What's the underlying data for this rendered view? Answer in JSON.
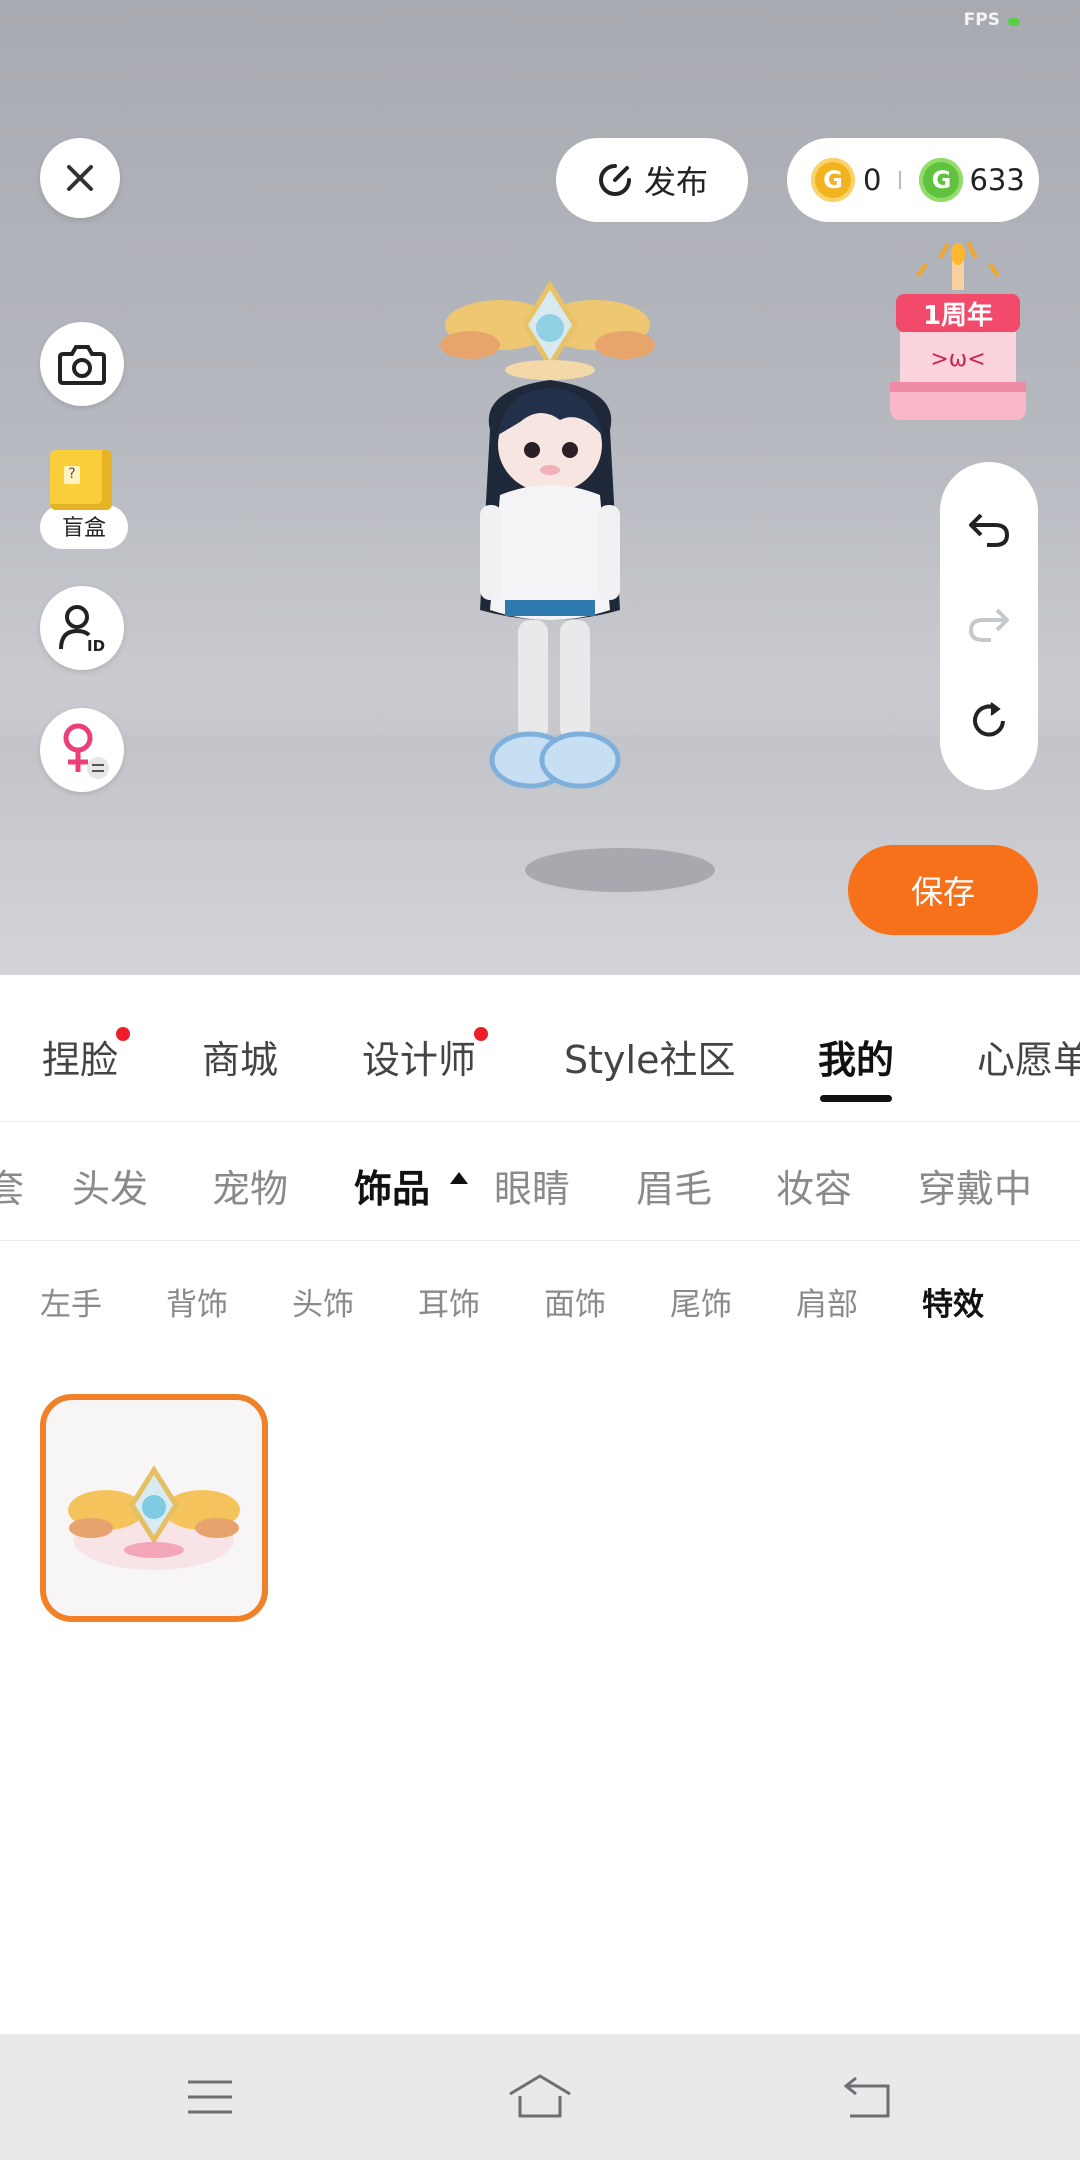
{
  "status_bar": {
    "fps_label": "FPS"
  },
  "top_bar": {
    "publish_label": "发布",
    "coins_gold": "0",
    "coins_green": "633"
  },
  "left_toolbar": {
    "blind_box_label": "盲盒"
  },
  "event_badge": {
    "text": "1周年"
  },
  "save_label": "保存",
  "main_tabs": [
    {
      "label": "捏脸",
      "has_dot": true
    },
    {
      "label": "商城",
      "has_dot": false
    },
    {
      "label": "设计师",
      "has_dot": true
    },
    {
      "label": "Style社区",
      "has_dot": false
    },
    {
      "label": "我的",
      "active": true
    },
    {
      "label": "心愿单"
    }
  ],
  "category_tabs": [
    {
      "label": "套"
    },
    {
      "label": "头发"
    },
    {
      "label": "宠物"
    },
    {
      "label": "饰品",
      "active": true
    },
    {
      "label": "眼睛"
    },
    {
      "label": "眉毛"
    },
    {
      "label": "妆容"
    },
    {
      "label": "穿戴中"
    }
  ],
  "sub_tabs": [
    {
      "label": "左手"
    },
    {
      "label": "背饰"
    },
    {
      "label": "头饰"
    },
    {
      "label": "耳饰"
    },
    {
      "label": "面饰"
    },
    {
      "label": "尾饰"
    },
    {
      "label": "肩部"
    },
    {
      "label": "特效",
      "active": true
    }
  ],
  "colors": {
    "accent_orange": "#f6711a",
    "item_border": "#f08128",
    "badge_red": "#ee1d2a",
    "coin_gold": "#f3b321",
    "coin_green": "#61c23f"
  }
}
